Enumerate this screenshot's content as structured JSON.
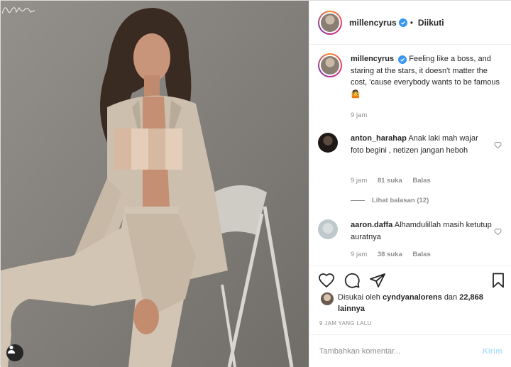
{
  "post": {
    "author": "millencyrus",
    "follow_status": "Diikuti",
    "follow_dot": "•"
  },
  "caption": {
    "username": "millencyrus",
    "text": "Feeling like a boss, and staring at the stars, it doesn't matter the cost, 'cause everybody wants to be famous",
    "emoji": "🤷",
    "time": "9 jam"
  },
  "comments": [
    {
      "username": "anton_harahap",
      "text": "Anak laki mah wajar foto begini , netizen jangan heboh",
      "time": "9 jam",
      "likes": "81 suka",
      "reply": "Balas"
    },
    {
      "username": "aaron.daffa",
      "text": "Alhamdulillah masih ketutup auratnya",
      "time": "9 jam",
      "likes": "38 suka",
      "reply": "Balas"
    }
  ],
  "view_replies": "Lihat balasan (12)",
  "likes_summary": {
    "prefix": "Disukai oleh",
    "user": "cyndyanalorens",
    "joiner": "dan",
    "others": "22,868 lainnya"
  },
  "time_ago": "9 JAM YANG LALU",
  "composer": {
    "placeholder": "Tambahkan komentar...",
    "post_label": "Kirim"
  },
  "colors": {
    "verified": "#3897f0",
    "text": "#262626",
    "muted": "#8e8e8e",
    "post_disabled": "#b2dffc"
  },
  "icons": {
    "like": "heart-icon",
    "comment": "comment-icon",
    "share": "paper-plane-icon",
    "save": "bookmark-icon",
    "tag": "person-tag-icon",
    "verified": "verified-badge-icon"
  }
}
